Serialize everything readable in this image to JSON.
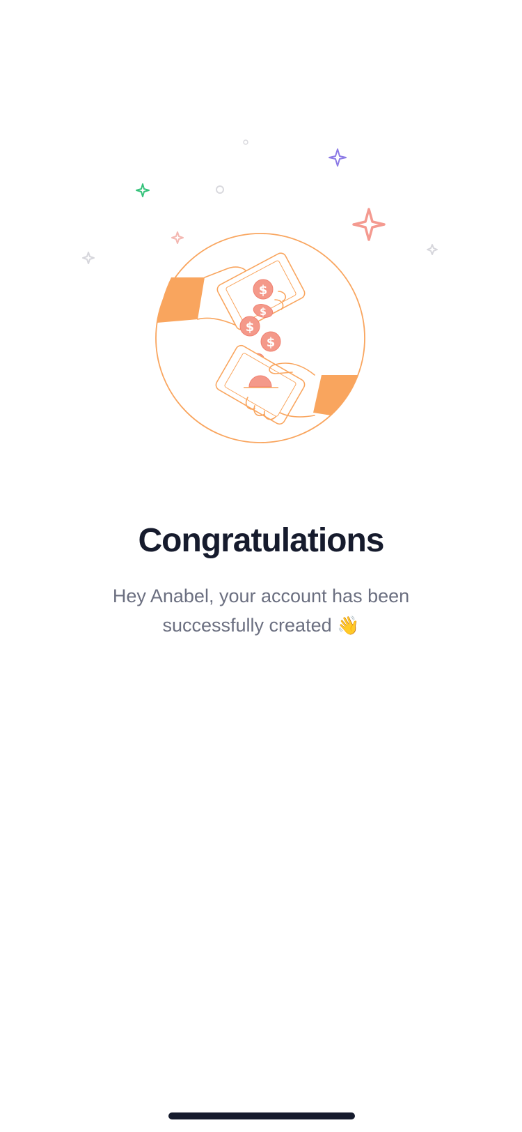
{
  "screen": {
    "title": "Congratulations",
    "message": "Hey Anabel, your account has been successfully created",
    "message_emoji": "👋"
  },
  "icons": {
    "illustration": "hands-exchanging-coins-illustration",
    "sparkles": [
      "sparkle-icon"
    ],
    "emoji_name": "waving-hand-icon"
  },
  "colors": {
    "accent_orange": "#f9a55e",
    "coin": "#f4998a",
    "title": "#161b2d",
    "body_text": "#6b6f80",
    "sparkle_purple": "#8c7ae6",
    "sparkle_green": "#34c27a",
    "sparkle_pink": "#f4a6a0",
    "sparkle_gray": "#d6d6dc"
  }
}
